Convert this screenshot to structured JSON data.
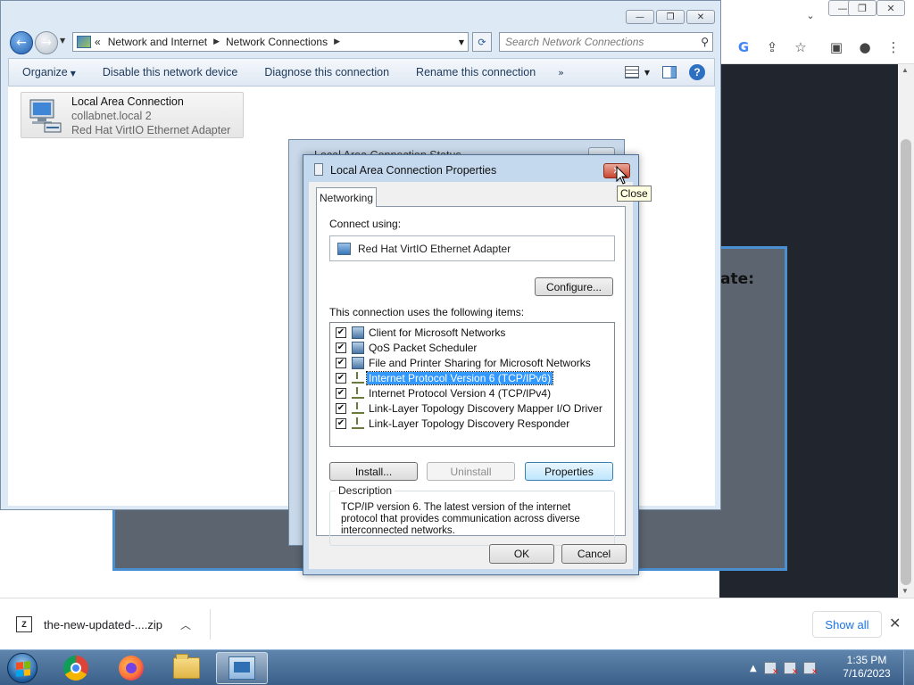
{
  "browser": {
    "page_heading_fragment": "iate:",
    "caption_buttons": {
      "minimize": "—",
      "restore": "❐",
      "close": "✕"
    },
    "toolbar_icons": [
      "google-g-icon",
      "share-icon",
      "bookmark-star-icon",
      "side-panel-icon",
      "profile-icon",
      "kebab-menu-icon"
    ],
    "download_bar": {
      "file_name": "the-new-updated-....zip",
      "show_all": "Show all"
    }
  },
  "explorer": {
    "breadcrumb": [
      "Network and Internet",
      "Network Connections"
    ],
    "breadcrumb_lead": "«",
    "search_placeholder": "Search Network Connections",
    "commands": {
      "organize": "Organize",
      "disable": "Disable this network device",
      "diagnose": "Diagnose this connection",
      "rename": "Rename this connection",
      "more": "»"
    },
    "connection": {
      "name": "Local Area Connection",
      "network": "collabnet.local  2",
      "adapter": "Red Hat VirtIO Ethernet Adapter"
    }
  },
  "status_dialog": {
    "title": "Local Area Connection Status"
  },
  "props_dialog": {
    "title": "Local Area Connection Properties",
    "tab": "Networking",
    "connect_using_label": "Connect using:",
    "adapter": "Red Hat VirtIO Ethernet Adapter",
    "configure": "Configure...",
    "items_label": "This connection uses the following items:",
    "items": [
      {
        "label": "Client for Microsoft Networks",
        "checked": true,
        "icon": "network-client-icon"
      },
      {
        "label": "QoS Packet Scheduler",
        "checked": true,
        "icon": "network-service-icon"
      },
      {
        "label": "File and Printer Sharing for Microsoft Networks",
        "checked": true,
        "icon": "network-service-icon"
      },
      {
        "label": "Internet Protocol Version 6 (TCP/IPv6)",
        "checked": true,
        "icon": "protocol-icon",
        "selected": true
      },
      {
        "label": "Internet Protocol Version 4 (TCP/IPv4)",
        "checked": true,
        "icon": "protocol-icon"
      },
      {
        "label": "Link-Layer Topology Discovery Mapper I/O Driver",
        "checked": true,
        "icon": "protocol-icon"
      },
      {
        "label": "Link-Layer Topology Discovery Responder",
        "checked": true,
        "icon": "protocol-icon"
      }
    ],
    "install": "Install...",
    "uninstall": "Uninstall",
    "properties": "Properties",
    "description_label": "Description",
    "description": "TCP/IP version 6. The latest version of the internet protocol that provides communication across diverse interconnected networks.",
    "ok": "OK",
    "cancel": "Cancel",
    "close_tooltip": "Close"
  },
  "taskbar": {
    "apps": [
      "chrome-icon",
      "firefox-icon",
      "file-explorer-icon",
      "network-connections-icon"
    ],
    "time": "1:35 PM",
    "date": "7/16/2023",
    "tray_arrow": "▲"
  }
}
